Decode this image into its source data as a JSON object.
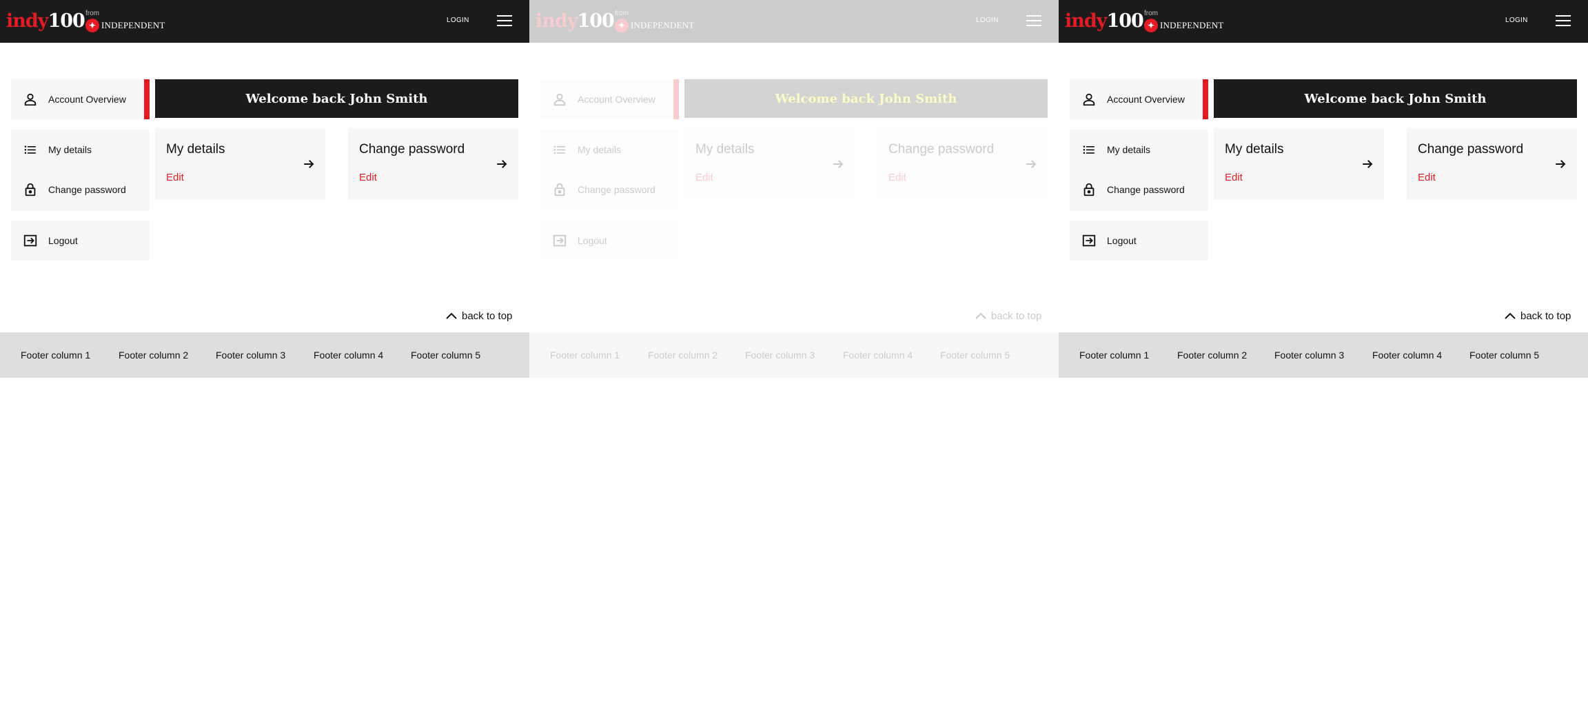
{
  "header": {
    "logo_indy": "indy",
    "logo_100": "100",
    "from_label": "from",
    "publisher_name": "INDEPENDENT",
    "publisher_emblem": "eagle-emblem",
    "login_label": "LOGIN",
    "menu_icon": "hamburger-menu-icon"
  },
  "sidebar": {
    "overview": {
      "label": "Account Overview",
      "icon": "person-icon"
    },
    "items": [
      {
        "label": "My details",
        "icon": "list-icon"
      },
      {
        "label": "Change password",
        "icon": "lock-icon"
      }
    ],
    "logout": {
      "label": "Logout",
      "icon": "logout-icon"
    }
  },
  "main": {
    "welcome": "Welcome back John Smith",
    "cards": [
      {
        "title": "My details",
        "action": "Edit",
        "icon": "arrow-right-icon"
      },
      {
        "title": "Change password",
        "action": "Edit",
        "icon": "arrow-right-icon"
      }
    ]
  },
  "back_to_top": {
    "label": "back to top",
    "icon": "chevron-up-icon"
  },
  "footer": {
    "columns": [
      "Footer column 1",
      "Footer column 2",
      "Footer column 3",
      "Footer column 4",
      "Footer column 5"
    ]
  },
  "colors": {
    "accent": "#e31b23",
    "header_bg": "#1b1b1b",
    "card_bg": "#f7f7f7",
    "footer_bg": "#dedede"
  }
}
